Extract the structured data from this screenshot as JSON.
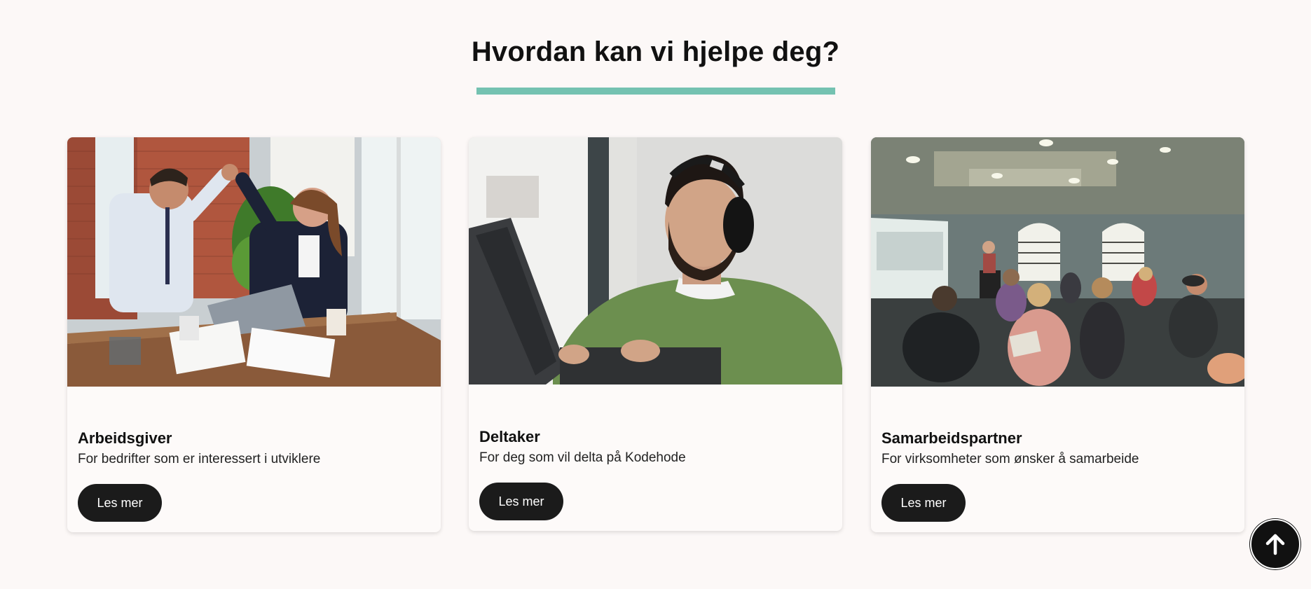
{
  "section": {
    "heading": "Hvordan kan vi hjelpe deg?",
    "accent_color": "#74c2b1",
    "background": "#fcf8f7"
  },
  "cards": [
    {
      "image": "office-high-five-photo",
      "title": "Arbeidsgiver",
      "description": "For bedrifter som er interessert i utviklere",
      "button_label": "Les mer"
    },
    {
      "image": "man-with-headphones-at-laptop-photo",
      "title": "Deltaker",
      "description": "For deg som vil delta på Kodehode",
      "button_label": "Les mer"
    },
    {
      "image": "classroom-presentation-photo",
      "title": "Samarbeidspartner",
      "description": "For virksomheter som ønsker å samarbeide",
      "button_label": "Les mer"
    }
  ],
  "scroll_top": {
    "icon": "arrow-up-icon"
  }
}
